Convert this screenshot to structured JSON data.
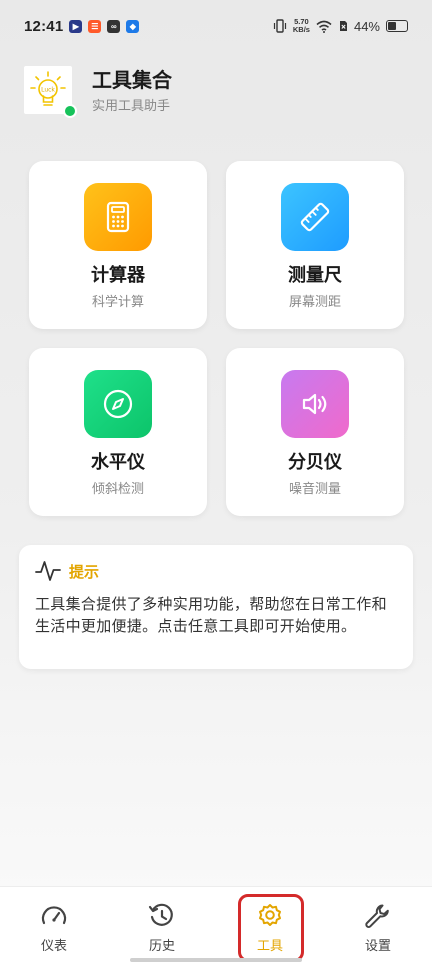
{
  "status_bar": {
    "time": "12:41",
    "speed_value": "5.70",
    "speed_unit": "KB/s",
    "battery_percent": "44%"
  },
  "header": {
    "title": "工具集合",
    "subtitle": "实用工具助手",
    "logo_text": "Luck"
  },
  "tools": [
    {
      "name": "计算器",
      "desc": "科学计算",
      "icon": "calculator-icon",
      "color_from": "#ffc21a",
      "color_to": "#ff9a00"
    },
    {
      "name": "测量尺",
      "desc": "屏幕测距",
      "icon": "ruler-icon",
      "color_from": "#3cc4ff",
      "color_to": "#1e9cff"
    },
    {
      "name": "水平仪",
      "desc": "倾斜检测",
      "icon": "compass-icon",
      "color_from": "#1fe08a",
      "color_to": "#0cc46a"
    },
    {
      "name": "分贝仪",
      "desc": "噪音测量",
      "icon": "speaker-icon",
      "color_from": "#c77af0",
      "color_to": "#f06acb"
    }
  ],
  "tip": {
    "title": "提示",
    "body": "工具集合提供了多种实用功能，帮助您在日常工作和生活中更加便捷。点击任意工具即可开始使用。"
  },
  "bottom_nav": {
    "items": [
      {
        "label": "仪表",
        "icon": "gauge-icon",
        "active": false
      },
      {
        "label": "历史",
        "icon": "history-icon",
        "active": false
      },
      {
        "label": "工具",
        "icon": "gear-icon",
        "active": true
      },
      {
        "label": "设置",
        "icon": "wrench-icon",
        "active": false
      }
    ]
  },
  "colors": {
    "accent": "#e3a500",
    "highlight": "#d42a2a",
    "online": "#16c25a"
  }
}
